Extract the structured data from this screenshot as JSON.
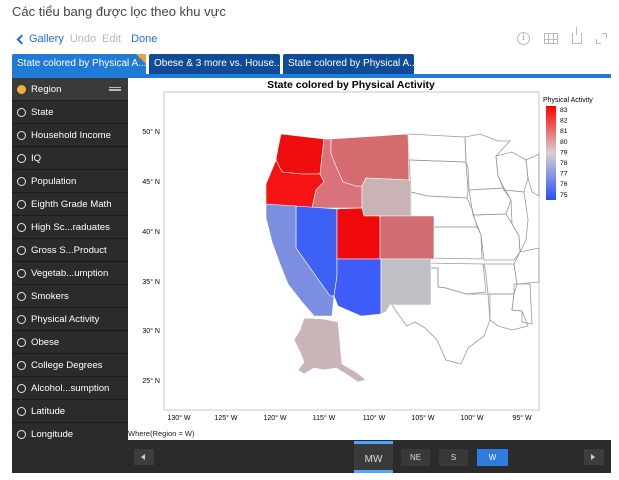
{
  "caption": "Các tiểu bang được lọc theo khu vực",
  "nav": {
    "back": "Gallery",
    "undo": "Undo",
    "edit": "Edit",
    "done": "Done",
    "icons": [
      "info-icon",
      "grid-icon",
      "share-icon",
      "expand-icon"
    ]
  },
  "tabs": [
    {
      "label": "State colored by Physical A..."
    },
    {
      "label": "Obese & 3 more vs. House..."
    },
    {
      "label": "State colored by Physical A..."
    }
  ],
  "sidebar": {
    "items": [
      {
        "label": "Region",
        "selected": true
      },
      {
        "label": "State"
      },
      {
        "label": "Household Income"
      },
      {
        "label": "IQ"
      },
      {
        "label": "Population"
      },
      {
        "label": "Eighth Grade Math"
      },
      {
        "label": "High Sc...raduates"
      },
      {
        "label": "Gross S...Product"
      },
      {
        "label": "Vegetab...umption"
      },
      {
        "label": "Smokers"
      },
      {
        "label": "Physical Activity"
      },
      {
        "label": "Obese"
      },
      {
        "label": "College Degrees"
      },
      {
        "label": "Alcohol...sumption"
      },
      {
        "label": "Latitude"
      },
      {
        "label": "Longitude"
      }
    ]
  },
  "map": {
    "title": "State colored by Physical Activity",
    "filter_label": "Where(Region = W)",
    "legend": {
      "title": "Physical Activity",
      "ticks": [
        "83",
        "82",
        "81",
        "80",
        "79",
        "78",
        "77",
        "76",
        "75"
      ],
      "colors": {
        "high": "#ff0000",
        "mid": "#d8d0d0",
        "low": "#2a4dff"
      }
    },
    "lat_ticks": [
      "50° N",
      "45° N",
      "40° N",
      "35° N",
      "30° N",
      "25° N"
    ],
    "lon_ticks": [
      "130° W",
      "125° W",
      "120° W",
      "115° W",
      "110° W",
      "105° W",
      "100° W",
      "95° W"
    ],
    "states_colored": [
      {
        "state": "Washington",
        "color": "#f00d0d"
      },
      {
        "state": "Oregon",
        "color": "#f51313"
      },
      {
        "state": "Idaho",
        "color": "#d9727a"
      },
      {
        "state": "Montana",
        "color": "#d56a6f"
      },
      {
        "state": "Wyoming",
        "color": "#c9b3b5"
      },
      {
        "state": "Nevada",
        "color": "#3d61f5"
      },
      {
        "state": "Utah",
        "color": "#f0080a"
      },
      {
        "state": "Colorado",
        "color": "#d06d72"
      },
      {
        "state": "California",
        "color": "#7b8ee0"
      },
      {
        "state": "Arizona",
        "color": "#3e5cf7"
      },
      {
        "state": "New Mexico",
        "color": "#bfbfc4"
      },
      {
        "state": "Alaska",
        "color": "#c9b4b6"
      }
    ]
  },
  "region_bar": {
    "current": "MW",
    "options": [
      "NE",
      "S",
      "W"
    ],
    "selected": "W"
  }
}
